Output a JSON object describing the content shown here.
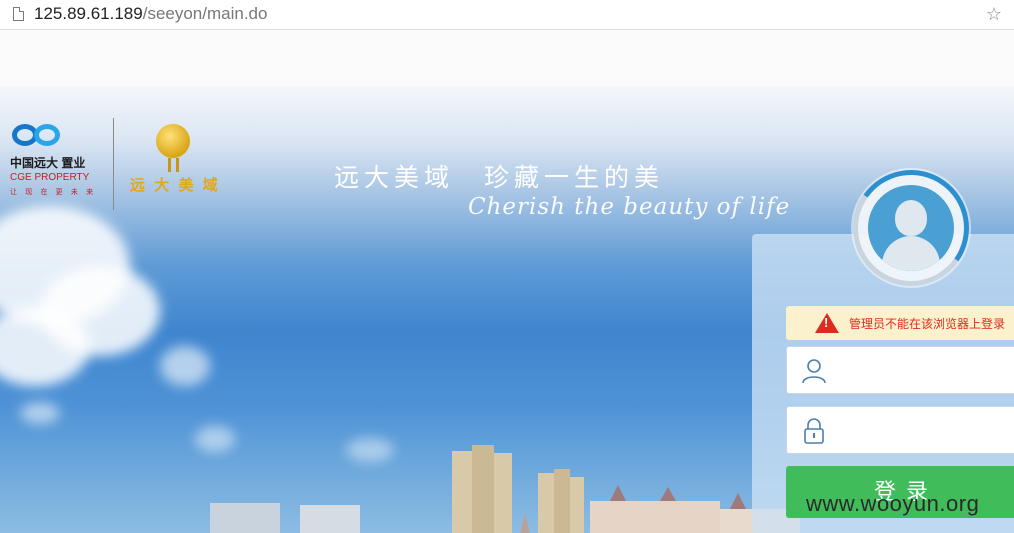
{
  "browser": {
    "url_host": "125.89.61.189",
    "url_path": "/seeyon/main.do"
  },
  "logos": {
    "cge_cn": "中国远大 置业",
    "cge_en": "CGE PROPERTY",
    "cge_slogan": "让 现 在   更 未 来",
    "ydmy_name": "远 大 美 域"
  },
  "hero": {
    "tagline_left": "远大美域",
    "tagline_right": "珍藏一生的美",
    "script": "Cherish the beauty of life"
  },
  "login": {
    "warning": "管理员不能在该浏览器上登录",
    "username_placeholder": "",
    "password_placeholder": "",
    "submit_label": "登录"
  },
  "watermark": "www.wooyun.org",
  "colors": {
    "accent_green": "#40bd5a",
    "warning_red": "#e02a1f",
    "warning_bg": "#fbf1cd",
    "logo_gold": "#e1a817"
  }
}
